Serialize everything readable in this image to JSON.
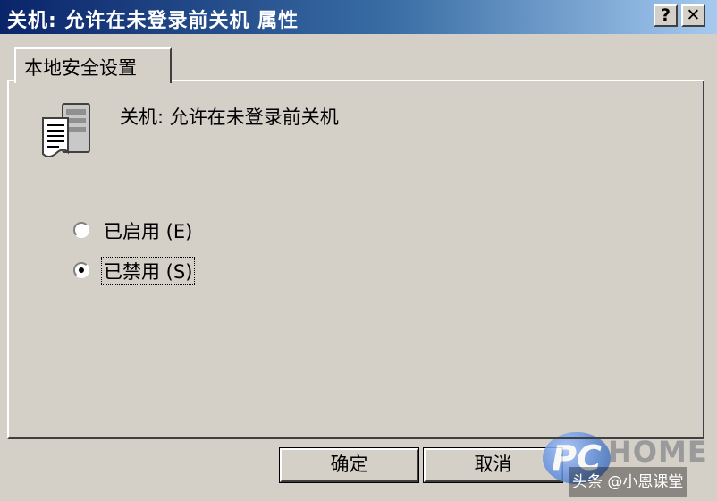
{
  "window": {
    "title": "关机: 允许在未登录前关机 属性",
    "help_label": "?",
    "close_label": "✕"
  },
  "tabs": [
    {
      "label": "本地安全设置",
      "selected": true
    }
  ],
  "policy": {
    "icon": "policy-server-icon",
    "name": "关机: 允许在未登录前关机"
  },
  "options": [
    {
      "label": "已启用 (E)",
      "checked": false
    },
    {
      "label": "已禁用 (S)",
      "checked": true
    }
  ],
  "buttons": {
    "ok_label": "确定",
    "cancel_label": "取消"
  },
  "watermark": {
    "pc_text": "PC",
    "home_text": "HOME",
    "credit": "头条 @小恩课堂"
  }
}
